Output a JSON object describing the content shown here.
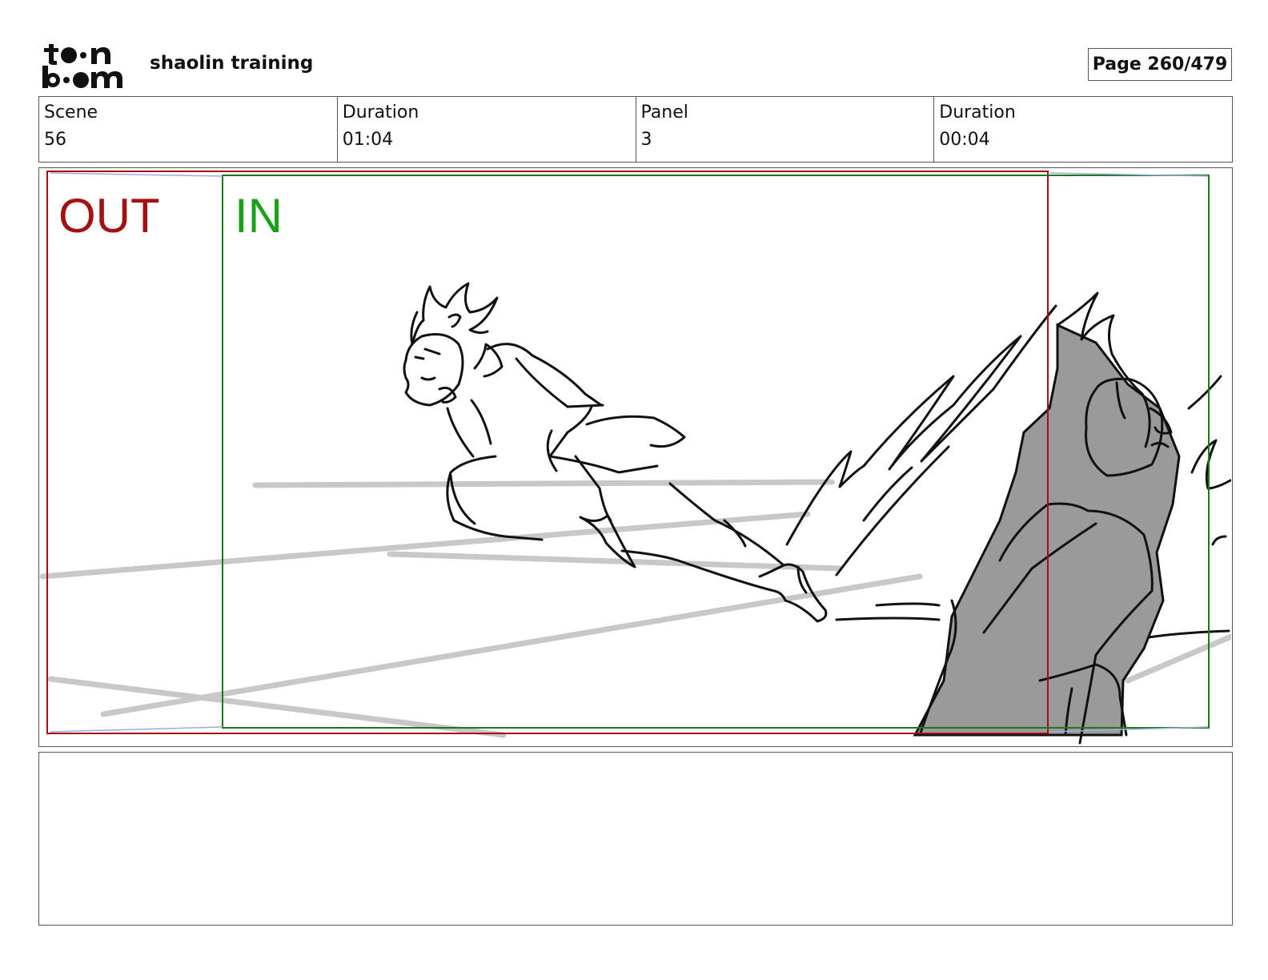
{
  "header": {
    "logo_text": "toon boom",
    "project_title": "shaolin training",
    "page_label": "Page 260/479"
  },
  "info": {
    "scene_label": "Scene",
    "scene_value": "56",
    "scene_duration_label": "Duration",
    "scene_duration_value": "01:04",
    "panel_label": "Panel",
    "panel_value": "3",
    "panel_duration_label": "Duration",
    "panel_duration_value": "00:04"
  },
  "panel": {
    "out_label": "OUT",
    "in_label": "IN",
    "colors": {
      "out_frame": "#a51010",
      "in_frame": "#1a7a1a",
      "in_text": "#1aa01a",
      "guide_lines": "#c8c8c8",
      "shadow_fill": "#9a9a9a"
    }
  },
  "notes": {
    "text": ""
  }
}
